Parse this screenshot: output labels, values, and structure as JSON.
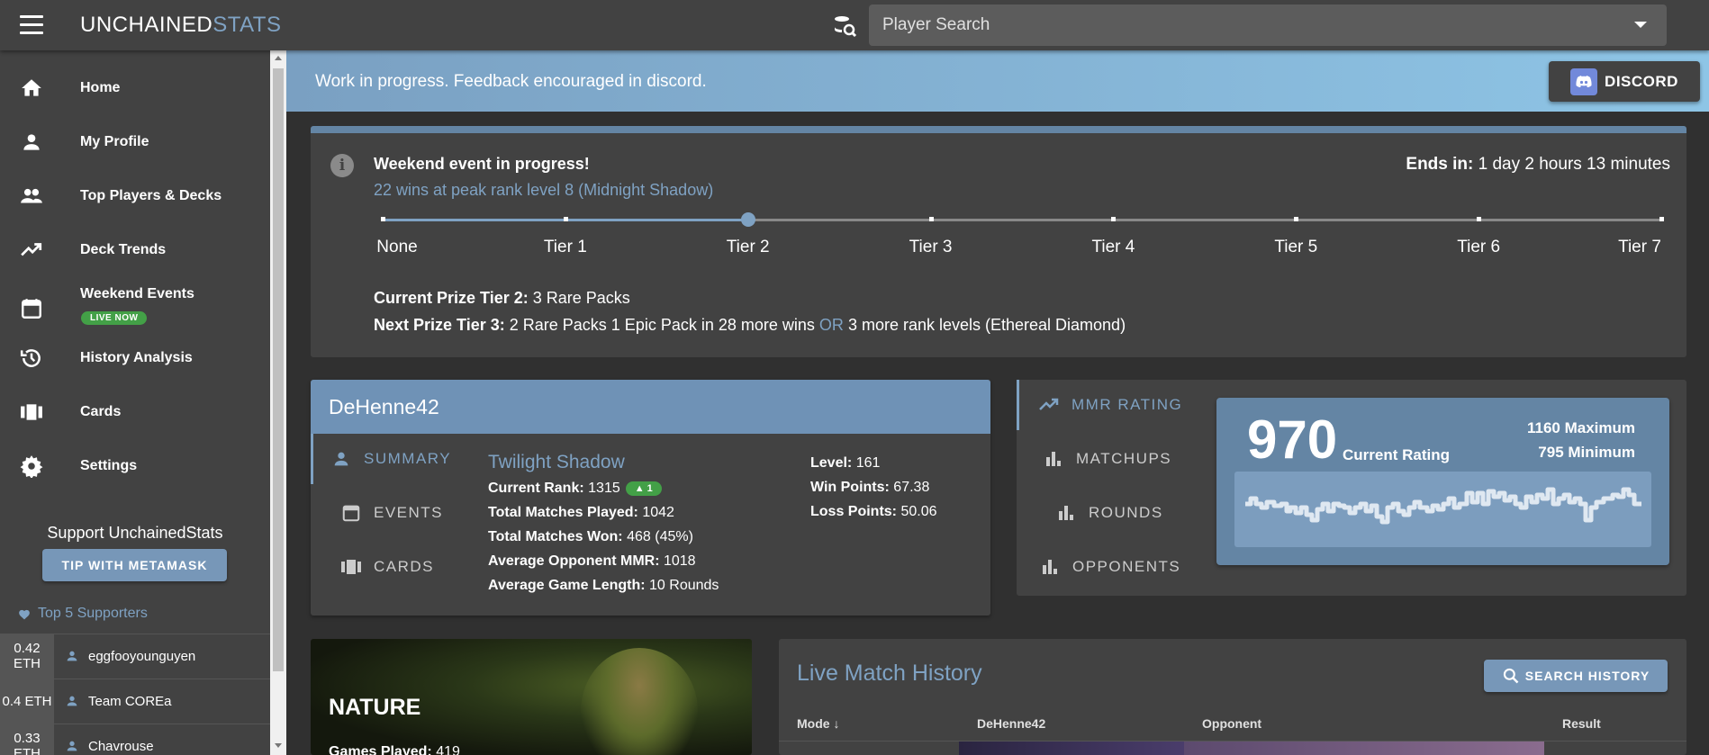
{
  "appbar": {
    "brand_part1": "UNCHAINED",
    "brand_part2": "STATS",
    "search_placeholder": "Player Search"
  },
  "sidebar": {
    "items": [
      {
        "label": "Home",
        "icon": "home-icon"
      },
      {
        "label": "My Profile",
        "icon": "person-icon"
      },
      {
        "label": "Top Players & Decks",
        "icon": "people-icon"
      },
      {
        "label": "Deck Trends",
        "icon": "trending-up-icon"
      },
      {
        "label": "Weekend Events",
        "icon": "calendar-icon",
        "badge": "LIVE NOW"
      },
      {
        "label": "History Analysis",
        "icon": "history-icon"
      },
      {
        "label": "Cards",
        "icon": "cards-icon"
      },
      {
        "label": "Settings",
        "icon": "gear-icon"
      }
    ],
    "support_title": "Support UnchainedStats",
    "tip_button": "TIP WITH METAMASK",
    "top_supporters_label": "Top 5 Supporters",
    "supporters": [
      {
        "amount": "0.42 ETH",
        "name": "eggfooyounguyen"
      },
      {
        "amount": "0.4 ETH",
        "name": "Team COREa"
      },
      {
        "amount": "0.33 ETH",
        "name": "Chavrouse"
      }
    ]
  },
  "banner": {
    "text": "Work in progress. Feedback encouraged in discord.",
    "discord_button": "DISCORD"
  },
  "event": {
    "title": "Weekend event in progress!",
    "subtitle": "22 wins at peak rank level 8 (Midnight Shadow)",
    "ends_label": "Ends in:",
    "ends_value": "1 day 2 hours 13 minutes",
    "tiers": [
      "None",
      "Tier 1",
      "Tier 2",
      "Tier 3",
      "Tier 4",
      "Tier 5",
      "Tier 6",
      "Tier 7"
    ],
    "current_tier_index": 2,
    "current_prize_label": "Current Prize Tier 2:",
    "current_prize_value": "3 Rare Packs",
    "next_prize_label": "Next Prize Tier 3:",
    "next_prize_value": "2 Rare Packs 1 Epic Pack in 28 more wins",
    "or_text": "OR",
    "next_prize_alt": "3 more rank levels (Ethereal Diamond)"
  },
  "player": {
    "name": "DeHenne42",
    "tabs": [
      "SUMMARY",
      "EVENTS",
      "CARDS"
    ],
    "rank_name": "Twilight Shadow",
    "current_rank_label": "Current Rank:",
    "current_rank_value": "1315",
    "rank_change": "▲ 1",
    "total_matches_label": "Total Matches Played:",
    "total_matches_value": "1042",
    "total_won_label": "Total Matches Won:",
    "total_won_value": "468 (45%)",
    "avg_opp_label": "Average Opponent MMR:",
    "avg_opp_value": "1018",
    "avg_len_label": "Average Game Length:",
    "avg_len_value": "10 Rounds",
    "level_label": "Level:",
    "level_value": "161",
    "win_points_label": "Win Points:",
    "win_points_value": "67.38",
    "loss_points_label": "Loss Points:",
    "loss_points_value": "50.06"
  },
  "mmr": {
    "tabs": [
      "MMR RATING",
      "MATCHUPS",
      "ROUNDS",
      "OPPONENTS"
    ],
    "rating": "970",
    "rating_label": "Current Rating",
    "max_text": "1160 Maximum",
    "min_text": "795 Minimum"
  },
  "deck": {
    "title": "NATURE",
    "games_label": "Games Played:",
    "games_value": "419"
  },
  "history": {
    "title": "Live Match History",
    "search_button": "SEARCH HISTORY",
    "columns": [
      "Mode",
      "DeHenne42",
      "Opponent",
      "Result"
    ]
  },
  "colors": {
    "accent": "#7fa2c3",
    "appbar": "#424242",
    "background": "#303030",
    "live_green": "#43a047"
  }
}
